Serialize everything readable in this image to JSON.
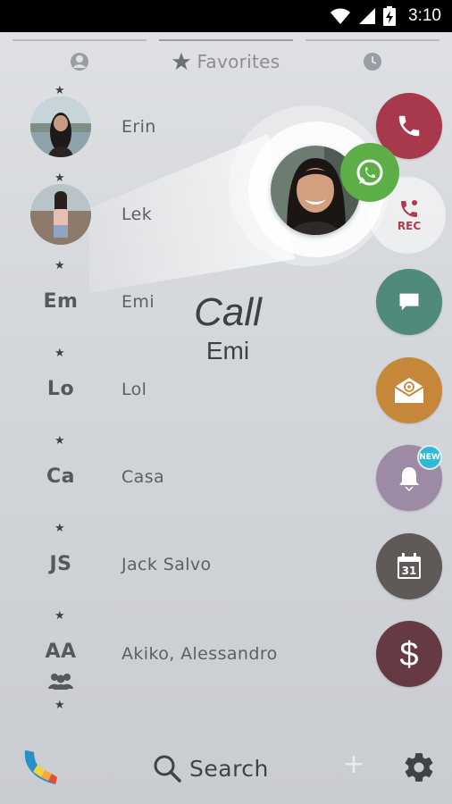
{
  "status_bar": {
    "time": "3:10",
    "icons": [
      "wifi-icon",
      "signal-icon",
      "battery-charging-icon"
    ]
  },
  "tabs": [
    {
      "icon": "person-icon",
      "label": ""
    },
    {
      "icon": "star-icon",
      "label": "Favorites"
    },
    {
      "icon": "clock-icon",
      "label": ""
    }
  ],
  "favorites": [
    {
      "name": "Erin",
      "initials": "",
      "photo": true
    },
    {
      "name": "Lek",
      "initials": "",
      "photo": true
    },
    {
      "name": "Emi",
      "initials": "Em",
      "photo": false
    },
    {
      "name": "Lol",
      "initials": "Lo",
      "photo": false
    },
    {
      "name": "Casa",
      "initials": "Ca",
      "photo": false
    },
    {
      "name": "Jack Salvo",
      "initials": "JS",
      "photo": false
    },
    {
      "name": "Akiko, Alessandro",
      "initials": "AA",
      "photo": false,
      "group": true
    }
  ],
  "drag_hint": {
    "action": "Call",
    "contact": "Emi"
  },
  "actions": [
    {
      "name": "call",
      "icon": "phone-icon",
      "color": "#a8384b"
    },
    {
      "name": "record-call",
      "icon": "phone-rec-icon",
      "label": "REC",
      "color": "#b23a4c"
    },
    {
      "name": "whatsapp",
      "icon": "whatsapp-icon",
      "color": "#5dae47"
    },
    {
      "name": "message",
      "icon": "chat-icon",
      "color": "#4f8a7c"
    },
    {
      "name": "email",
      "icon": "email-icon",
      "color": "#c7873a"
    },
    {
      "name": "reminder",
      "icon": "bell-icon",
      "badge": "NEW",
      "color": "#9d8aa5"
    },
    {
      "name": "calendar",
      "icon": "calendar-icon",
      "date": "31",
      "color": "#5f5a58"
    },
    {
      "name": "payment",
      "icon": "dollar-icon",
      "color": "#663a43"
    }
  ],
  "bottom_bar": {
    "search_label": "Search"
  }
}
